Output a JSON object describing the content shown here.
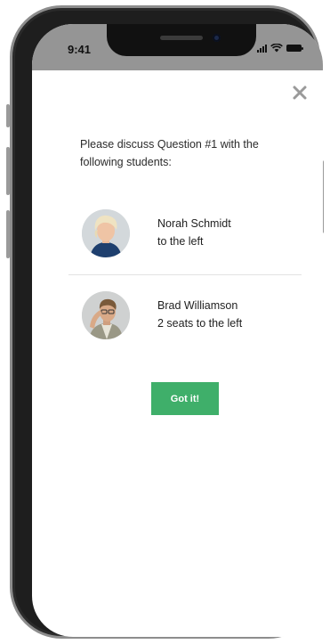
{
  "status_bar": {
    "time": "9:41",
    "icons": [
      "signal-icon",
      "wifi-icon",
      "battery-icon"
    ]
  },
  "dialog": {
    "close_icon": "close-icon",
    "prompt": "Please discuss Question #1 with the following students:",
    "students": [
      {
        "name": "Norah Schmidt",
        "position": "to the left"
      },
      {
        "name": "Brad Williamson",
        "position": "2 seats to the left"
      }
    ],
    "confirm_label": "Got it!"
  },
  "colors": {
    "accent": "#3faf6a",
    "status_bar_bg": "#959595",
    "text": "#2b2b2b",
    "close_icon": "#9a9a9a"
  }
}
